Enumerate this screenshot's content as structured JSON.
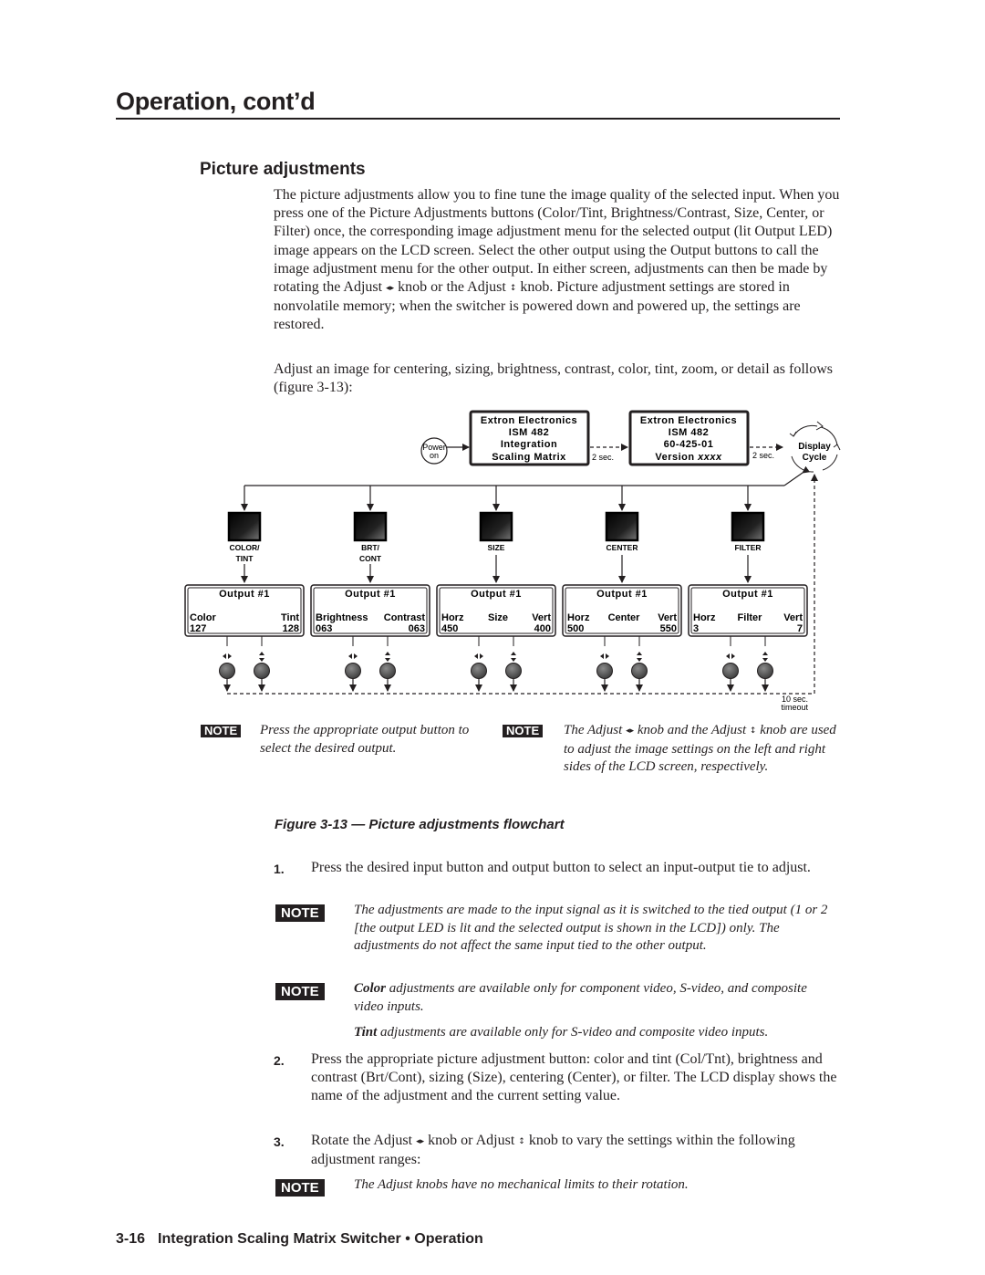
{
  "header": {
    "section_title": "Operation, cont’d",
    "subsection_title": "Picture adjustments"
  },
  "intro": {
    "p1_a": "The picture adjustments allow you to fine tune the image quality of the selected input.  When you press one of the Picture Adjustments buttons (Color/Tint, Brightness/Contrast, Size, Center, or Filter) once, the corresponding image adjustment menu for the selected output (lit Output LED) image appears on the LCD screen.  Select the other output using the Output buttons to call the image adjustment menu for the other output.  In either screen, adjustments can then be made by rotating the Adjust ",
    "p1_b": " knob or the Adjust ",
    "p1_c": " knob.  Picture adjustment settings are stored in nonvolatile memory; when the switcher is powered down and powered up, the settings are restored.",
    "p2": "Adjust an image for centering, sizing, brightness, contrast, color, tint, zoom, or detail as follows (figure 3-13):"
  },
  "icons": {
    "knob_horizontal": "◂▸",
    "knob_vertical": "↕"
  },
  "flowchart": {
    "power_label_1": "Power",
    "power_label_2": "on",
    "startup_lcd_1": [
      "Extron Electronics",
      "ISM 482",
      "Integration",
      "Scaling Matrix"
    ],
    "startup_lcd_2": [
      "Extron Electronics",
      "ISM 482",
      "60-425-01",
      "Version "
    ],
    "version_placeholder": "xxxx",
    "delay_1": "2 sec.",
    "delay_2": "2 sec.",
    "display_cycle_1": "Display",
    "display_cycle_2": "Cycle",
    "timeout_1": "10 sec.",
    "timeout_2": "timeout",
    "adjustments": [
      {
        "button_label_1": "COLOR/",
        "button_label_2": "TINT",
        "lcd_title": "Output #1",
        "left_label": "Color",
        "center_label": "",
        "right_label": "Tint",
        "left_value": "127",
        "right_value": "128"
      },
      {
        "button_label_1": "BRT/",
        "button_label_2": "CONT",
        "lcd_title": "Output #1",
        "left_label": "Brightness",
        "center_label": "",
        "right_label": "Contrast",
        "left_value": "063",
        "right_value": "063"
      },
      {
        "button_label_1": "SIZE",
        "button_label_2": "",
        "lcd_title": "Output #1",
        "left_label": "Horz",
        "center_label": "Size",
        "right_label": "Vert",
        "left_value": "450",
        "right_value": "400"
      },
      {
        "button_label_1": "CENTER",
        "button_label_2": "",
        "lcd_title": "Output #1",
        "left_label": "Horz",
        "center_label": "Center",
        "right_label": "Vert",
        "left_value": "500",
        "right_value": "550"
      },
      {
        "button_label_1": "FILTER",
        "button_label_2": "",
        "lcd_title": "Output #1",
        "left_label": "Horz",
        "center_label": "Filter",
        "right_label": "Vert",
        "left_value": " 3",
        "right_value": "7"
      }
    ]
  },
  "figure_notes": {
    "badge": "NOTE",
    "left": "Press the appropriate output button to select the desired output.",
    "right_a": "The Adjust ",
    "right_b": " knob and the Adjust ",
    "right_c": " knob are used to adjust the image settings on the left and right sides of the LCD screen, respectively."
  },
  "figure_caption": "Figure 3-13 — Picture adjustments flowchart",
  "steps": [
    {
      "number": "1.",
      "text": "Press the desired input button and output button to select an input-output tie to adjust."
    },
    {
      "number": "2.",
      "text": "Press the appropriate picture adjustment button: color and tint (Col/Tnt), brightness and contrast (Brt/Cont), sizing (Size), centering (Center), or filter. The LCD display shows the name of the adjustment and the current setting value."
    },
    {
      "number": "3.",
      "text_a": "Rotate the Adjust ",
      "text_b": " knob or Adjust ",
      "text_c": " knob to vary the settings within the following adjustment ranges:"
    }
  ],
  "notes": {
    "badge": "NOTE",
    "n1": "The adjustments are made to the input signal as it is switched to the tied output (1 or 2 [the output LED is lit and the selected output is shown in the LCD]) only.  The adjustments do not affect the same input tied to the other output.",
    "n2_bold": "Color",
    "n2": " adjustments are available only for component video, S-video, and composite video inputs.",
    "n3_bold": "Tint",
    "n3": " adjustments are available only for S-video and composite video inputs.",
    "n4": "The Adjust knobs have no mechanical limits to their rotation."
  },
  "footer": {
    "page": "3-16",
    "title": "Integration Scaling Matrix Switcher • Operation"
  }
}
